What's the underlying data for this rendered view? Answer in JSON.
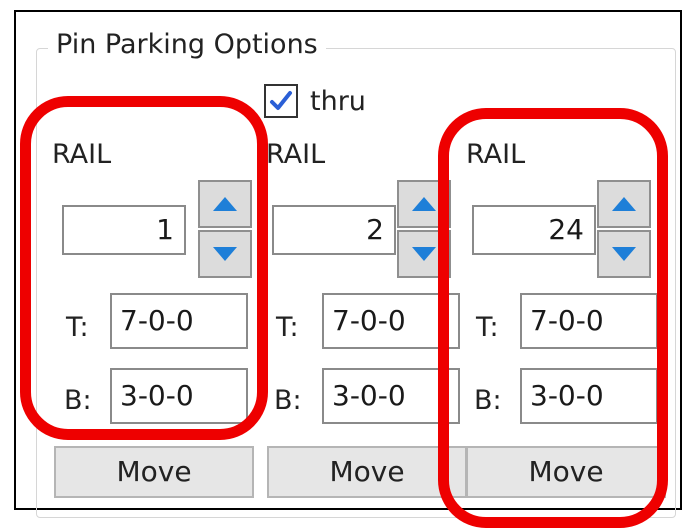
{
  "group": {
    "title": "Pin Parking Options"
  },
  "thru": {
    "label": "thru",
    "checked": true
  },
  "columns": [
    {
      "rail_label": "RAIL",
      "rail_value": "1",
      "t_label": "T:",
      "t_value": "7-0-0",
      "b_label": "B:",
      "b_value": "3-0-0",
      "move_label": "Move"
    },
    {
      "rail_label": "RAIL",
      "rail_value": "2",
      "t_label": "T:",
      "t_value": "7-0-0",
      "b_label": "B:",
      "b_value": "3-0-0",
      "move_label": "Move"
    },
    {
      "rail_label": "RAIL",
      "rail_value": "24",
      "t_label": "T:",
      "t_value": "7-0-0",
      "b_label": "B:",
      "b_value": "3-0-0",
      "move_label": "Move"
    }
  ],
  "icons": {
    "checkbox": "checkmark-icon",
    "spin_up": "arrow-up-icon",
    "spin_down": "arrow-down-icon"
  },
  "colors": {
    "highlight": "#ee0000",
    "arrow": "#1e7fd8",
    "checkmark": "#2a5fd6"
  }
}
